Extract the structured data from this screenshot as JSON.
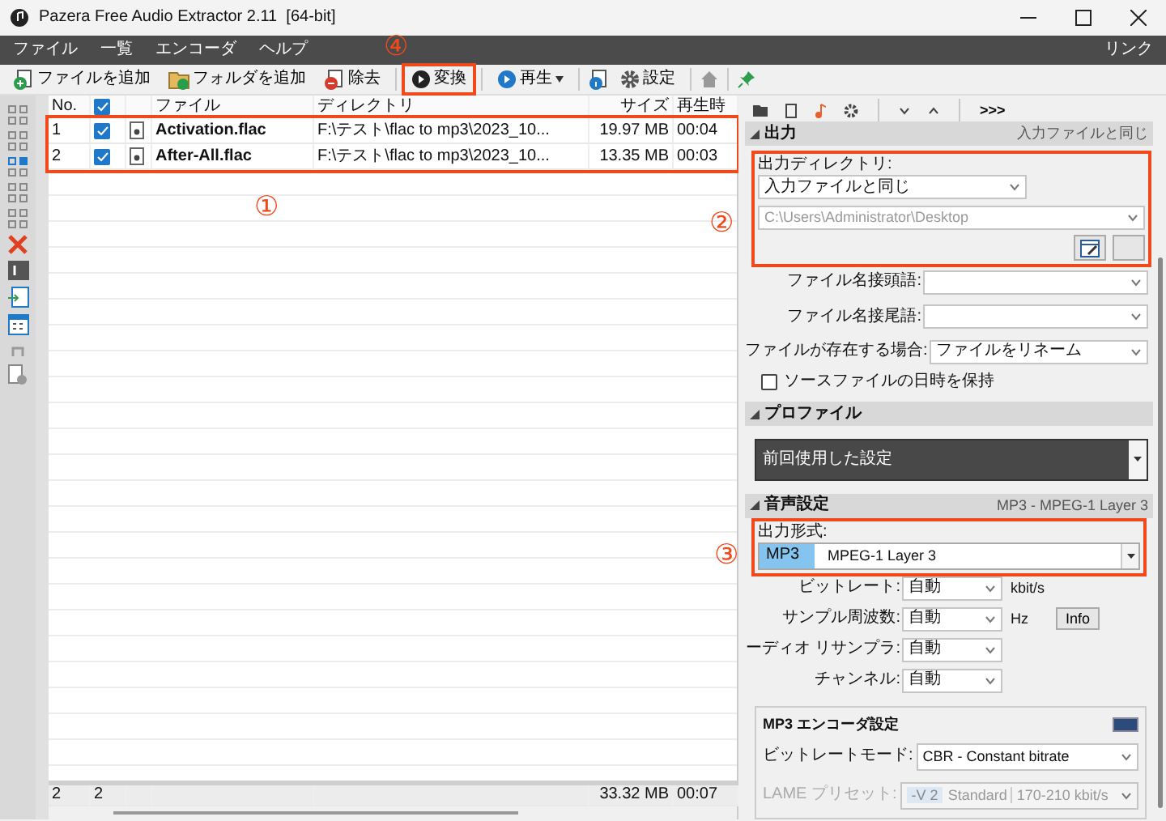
{
  "window": {
    "title": "Pazera Free Audio Extractor 2.11  [64-bit]"
  },
  "menu": {
    "items": [
      "ファイル",
      "一覧",
      "エンコーダ",
      "ヘルプ"
    ],
    "right": "リンク"
  },
  "toolbar": [
    {
      "kind": "add-file",
      "label": "ファイルを追加"
    },
    {
      "kind": "add-folder",
      "label": "フォルダを追加"
    },
    {
      "kind": "remove",
      "label": "除去"
    },
    {
      "kind": "convert",
      "label": "変換"
    },
    {
      "kind": "play",
      "label": "再生"
    },
    {
      "kind": "info"
    },
    {
      "kind": "settings",
      "label": "設定"
    },
    {
      "kind": "home"
    },
    {
      "kind": "pin"
    }
  ],
  "file_list": {
    "header_checked": true,
    "columns": [
      "No.",
      "ファイル",
      "ディレクトリ",
      "サイズ",
      "再生時"
    ],
    "rows": [
      {
        "no": "1",
        "checked": true,
        "file": "Activation.flac",
        "directory": "F:\\テスト\\flac to mp3\\2023_10...",
        "size": "19.97 MB",
        "duration": "00:04"
      },
      {
        "no": "2",
        "checked": true,
        "file": "After-All.flac",
        "directory": "F:\\テスト\\flac to mp3\\2023_10...",
        "size": "13.35 MB",
        "duration": "00:03"
      }
    ],
    "footer": {
      "count": "2",
      "checked_count": "2",
      "total_size": "33.32 MB",
      "total_time": "00:07"
    }
  },
  "panel_tabs": [
    {
      "kind": "folder",
      "selected": false
    },
    {
      "kind": "document",
      "selected": false
    },
    {
      "kind": "note",
      "selected": true
    },
    {
      "kind": "gear",
      "selected": false
    },
    {
      "kind": "down"
    },
    {
      "kind": "up"
    },
    {
      "kind": "more",
      "label": ">>>"
    }
  ],
  "output": {
    "title": "出力",
    "summary": "入力ファイルと同じ",
    "directory_label": "出力ディレクトリ:",
    "directory_mode": "入力ファイルと同じ",
    "directory_path": "C:\\Users\\Administrator\\Desktop",
    "fields": [
      {
        "label": "ファイル名接頭語:"
      },
      {
        "label": "ファイル名接尾語:"
      },
      {
        "label": "ファイルが存在する場合:",
        "value": "ファイルをリネーム"
      }
    ],
    "keep_date": {
      "label": "ソースファイルの日時を保持",
      "checked": false
    }
  },
  "profile": {
    "title": "プロファイル",
    "value": "前回使用した設定"
  },
  "audio": {
    "title": "音声設定",
    "summary": "MP3 - MPEG-1 Layer 3",
    "format_label": "出力形式:",
    "format_code": "MP3",
    "format_name": "MPEG-1 Layer 3",
    "fields": [
      {
        "label": "ビットレート:",
        "value": "自動",
        "unit": "kbit/s"
      },
      {
        "label": "サンプル周波数:",
        "value": "自動",
        "unit": "Hz",
        "button": "Info"
      },
      {
        "label": "ーディオ リサンプラ:",
        "value": "自動"
      },
      {
        "label": "チャンネル:",
        "value": "自動"
      }
    ]
  },
  "encoder": {
    "title": "MP3 エンコーダ設定",
    "fields": [
      {
        "label": "ビットレートモード:",
        "value": "CBR - Constant bitrate",
        "disabled": false
      },
      {
        "label": "LAME プリセット:",
        "preset": "-V 2",
        "value": "Standard",
        "range": "170-210 kbit/s",
        "disabled": true
      }
    ]
  },
  "annotations": [
    {
      "marker": "④"
    },
    {
      "marker": "①"
    },
    {
      "marker": "②"
    },
    {
      "marker": "③"
    }
  ]
}
